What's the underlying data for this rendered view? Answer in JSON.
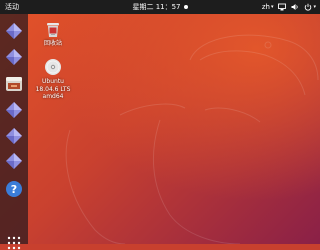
{
  "topbar": {
    "activities": "活动",
    "clock": "星期二 11：57",
    "input_method": "zh",
    "input_method_caret": "▾",
    "network_icon": "network-icon",
    "volume_icon": "volume-icon",
    "power_icon": "power-icon",
    "system_menu_caret": "▾"
  },
  "dock": {
    "apps": [
      {
        "icon": "cube-app-icon"
      },
      {
        "icon": "cube-app-icon"
      },
      {
        "icon": "file-manager-icon"
      },
      {
        "icon": "cube-app-icon"
      },
      {
        "icon": "cube-app-icon"
      },
      {
        "icon": "cube-app-icon"
      },
      {
        "icon": "help-icon",
        "glyph": "?"
      }
    ],
    "show_apps_icon": "grid-icon"
  },
  "desktop": {
    "trash_label": "回收站",
    "disc_label_line1": "Ubuntu",
    "disc_label_line2": "18.04.6 LTS",
    "disc_label_line3": "amd64"
  },
  "colors": {
    "wallpaper_orange": "#e55428",
    "wallpaper_purple": "#8a2047",
    "topbar": "#1d1d1d",
    "help_blue": "#3b7dd8"
  }
}
